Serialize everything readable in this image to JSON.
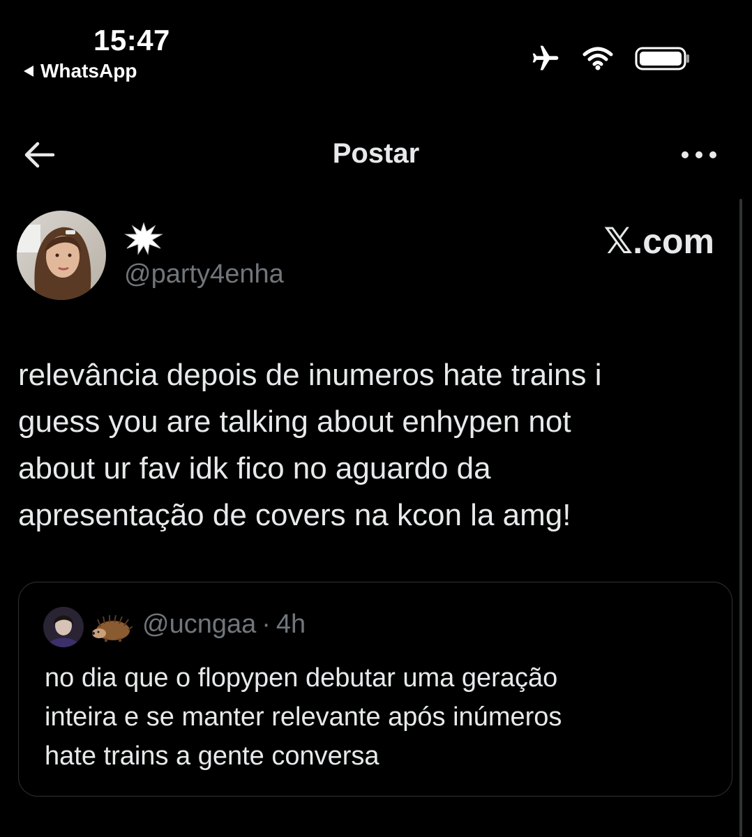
{
  "status_bar": {
    "time": "15:47",
    "back_app": "WhatsApp",
    "icons": [
      "airplane-icon",
      "wifi-icon",
      "battery-icon"
    ]
  },
  "header": {
    "title": "Postar",
    "back_icon": "arrow-left-icon",
    "more_icon": "more-dots-icon"
  },
  "post": {
    "author_handle": "@party4enha",
    "author_name_icon": "burst-emoji-icon",
    "source": ".com",
    "source_mark": "𝕏",
    "text_lines": [
      "relevância depois de inumeros hate trains i",
      "guess you are talking about enhypen not",
      "about ur fav idk fico no aguardo da",
      "apresentação de covers na kcon la amg!"
    ]
  },
  "quote": {
    "handle": "@ucngaa",
    "separator": "·",
    "time": "4h",
    "name_icon": "hedgehog-emoji-icon",
    "text_lines": [
      "no dia que o flopypen debutar uma geração",
      "inteira e se manter relevante após inúmeros",
      "hate trains a gente conversa"
    ]
  },
  "colors": {
    "background": "#000000",
    "text": "#e7e9ea",
    "secondary": "#71767b",
    "border": "#2f3336"
  }
}
